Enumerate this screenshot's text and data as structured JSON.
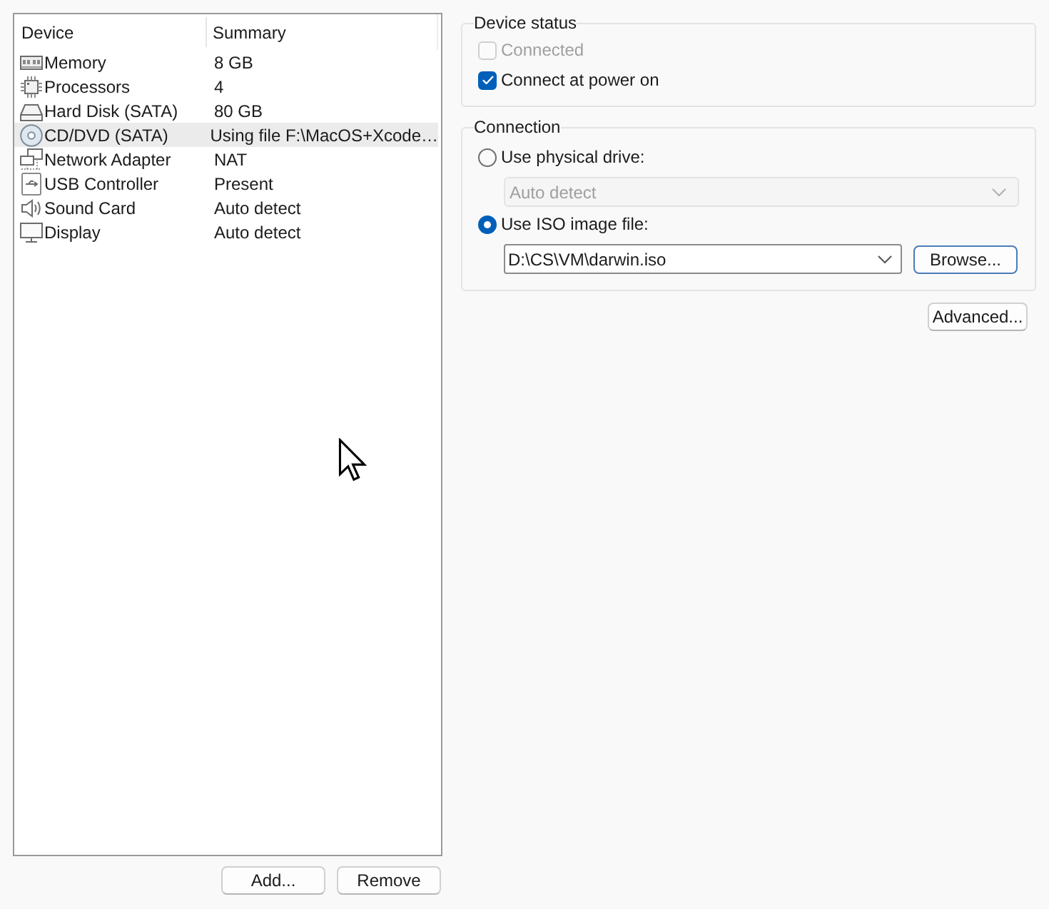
{
  "device_table": {
    "columns": [
      "Device",
      "Summary"
    ],
    "rows": [
      {
        "kind": "memory",
        "device": "Memory",
        "summary": "8 GB",
        "selected": false
      },
      {
        "kind": "processor",
        "device": "Processors",
        "summary": "4",
        "selected": false
      },
      {
        "kind": "disk",
        "device": "Hard Disk (SATA)",
        "summary": "80 GB",
        "selected": false
      },
      {
        "kind": "cd",
        "device": "CD/DVD (SATA)",
        "summary": "Using file F:\\MacOS+Xcode…",
        "selected": true
      },
      {
        "kind": "network",
        "device": "Network Adapter",
        "summary": "NAT",
        "selected": false
      },
      {
        "kind": "usb",
        "device": "USB Controller",
        "summary": "Present",
        "selected": false
      },
      {
        "kind": "sound",
        "device": "Sound Card",
        "summary": "Auto detect",
        "selected": false
      },
      {
        "kind": "display",
        "device": "Display",
        "summary": "Auto detect",
        "selected": false
      }
    ]
  },
  "list_buttons": [
    "Add...",
    "Remove"
  ],
  "device_status": {
    "title": "Device status",
    "checkboxes": [
      {
        "label": "Connected",
        "checked": false,
        "disabled": true
      },
      {
        "label": "Connect at power on",
        "checked": true,
        "disabled": false
      }
    ]
  },
  "connection": {
    "title": "Connection",
    "options": [
      {
        "label": "Use physical drive:",
        "selected": false,
        "dropdown": {
          "value": "Auto detect",
          "disabled": true
        }
      },
      {
        "label": "Use ISO image file:",
        "selected": true,
        "path_field": {
          "value": "D:\\CS\\VM\\darwin.iso"
        },
        "button": "Browse..."
      }
    ]
  },
  "advanced_button": "Advanced..."
}
